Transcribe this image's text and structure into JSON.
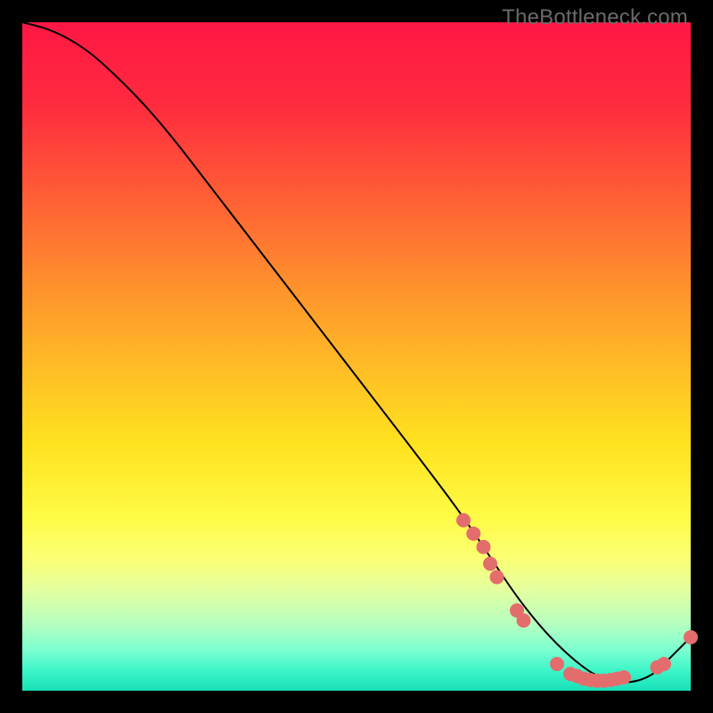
{
  "watermark": "TheBottleneck.com",
  "chart_data": {
    "type": "line",
    "title": "",
    "xlabel": "",
    "ylabel": "",
    "xlim": [
      0,
      100
    ],
    "ylim": [
      0,
      100
    ],
    "curve": {
      "x": [
        0,
        4,
        8,
        12,
        20,
        30,
        40,
        50,
        60,
        66,
        70,
        74,
        78,
        82,
        86,
        90,
        94,
        97,
        100
      ],
      "y": [
        100,
        99,
        97,
        94,
        86,
        73,
        60,
        47,
        34,
        26,
        20,
        14,
        9,
        5,
        2,
        1,
        2,
        5,
        8
      ]
    },
    "markers": [
      {
        "x": 66.0,
        "y": 25.5
      },
      {
        "x": 67.5,
        "y": 23.5
      },
      {
        "x": 69.0,
        "y": 21.5
      },
      {
        "x": 70.0,
        "y": 19.0
      },
      {
        "x": 71.0,
        "y": 17.0
      },
      {
        "x": 74.0,
        "y": 12.0
      },
      {
        "x": 75.0,
        "y": 10.5
      },
      {
        "x": 80.0,
        "y": 4.0
      },
      {
        "x": 82.0,
        "y": 2.5
      },
      {
        "x": 83.0,
        "y": 2.2
      },
      {
        "x": 84.0,
        "y": 1.8
      },
      {
        "x": 85.0,
        "y": 1.6
      },
      {
        "x": 86.0,
        "y": 1.5
      },
      {
        "x": 87.0,
        "y": 1.5
      },
      {
        "x": 88.0,
        "y": 1.6
      },
      {
        "x": 89.0,
        "y": 1.8
      },
      {
        "x": 90.0,
        "y": 2.0
      },
      {
        "x": 95.0,
        "y": 3.5
      },
      {
        "x": 96.0,
        "y": 4.0
      },
      {
        "x": 100.0,
        "y": 8.0
      }
    ],
    "marker_color": "#e36d6d",
    "marker_radius": 8,
    "curve_color": "#000000",
    "curve_width": 2
  }
}
